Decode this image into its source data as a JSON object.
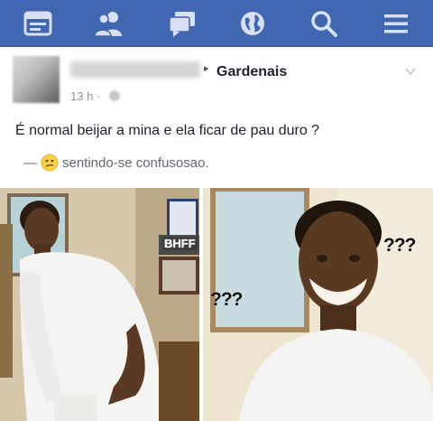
{
  "topbar": {
    "bg_color": "#4267b2",
    "icons": [
      "news-feed-icon",
      "friends-icon",
      "messages-icon",
      "notifications-globe-icon",
      "search-icon",
      "menu-icon"
    ]
  },
  "post": {
    "author_arrow": "▸",
    "group_name": "Gardenais",
    "time": "13 h ·",
    "text": "É normal beijar a mina e ela ficar de pau duro ?",
    "feeling_dash": "—",
    "feeling_text": "sentindo-se confusosao.",
    "feeling_emoji": "confused-face-icon"
  },
  "meme": {
    "left_panel_label": "BHFF",
    "question_marks_right": "???",
    "question_marks_center": "???"
  }
}
